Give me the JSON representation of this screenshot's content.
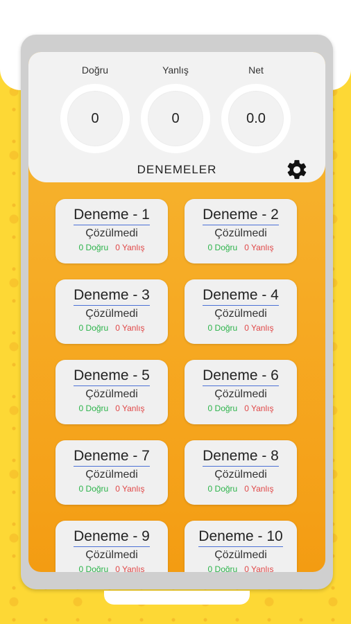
{
  "stats": [
    {
      "label": "Doğru",
      "value": "0"
    },
    {
      "label": "Yanlış",
      "value": "0"
    },
    {
      "label": "Net",
      "value": "0.0"
    }
  ],
  "header": {
    "title": "DENEMELER"
  },
  "cards": [
    {
      "title": "Deneme - 1",
      "status": "Çözülmedi",
      "dogru": "0 Doğru",
      "yanlis": "0 Yanlış"
    },
    {
      "title": "Deneme - 2",
      "status": "Çözülmedi",
      "dogru": "0 Doğru",
      "yanlis": "0 Yanlış"
    },
    {
      "title": "Deneme - 3",
      "status": "Çözülmedi",
      "dogru": "0 Doğru",
      "yanlis": "0 Yanlış"
    },
    {
      "title": "Deneme - 4",
      "status": "Çözülmedi",
      "dogru": "0 Doğru",
      "yanlis": "0 Yanlış"
    },
    {
      "title": "Deneme - 5",
      "status": "Çözülmedi",
      "dogru": "0 Doğru",
      "yanlis": "0 Yanlış"
    },
    {
      "title": "Deneme - 6",
      "status": "Çözülmedi",
      "dogru": "0 Doğru",
      "yanlis": "0 Yanlış"
    },
    {
      "title": "Deneme - 7",
      "status": "Çözülmedi",
      "dogru": "0 Doğru",
      "yanlis": "0 Yanlış"
    },
    {
      "title": "Deneme - 8",
      "status": "Çözülmedi",
      "dogru": "0 Doğru",
      "yanlis": "0 Yanlış"
    },
    {
      "title": "Deneme - 9",
      "status": "Çözülmedi",
      "dogru": "0 Doğru",
      "yanlis": "0 Yanlış"
    },
    {
      "title": "Deneme - 10",
      "status": "Çözülmedi",
      "dogru": "0 Doğru",
      "yanlis": "0 Yanlış"
    }
  ],
  "icons": {
    "settings": "gear-icon"
  },
  "colors": {
    "accent": "#f5a21a",
    "correct": "#2bb34a",
    "wrong": "#e04848"
  }
}
